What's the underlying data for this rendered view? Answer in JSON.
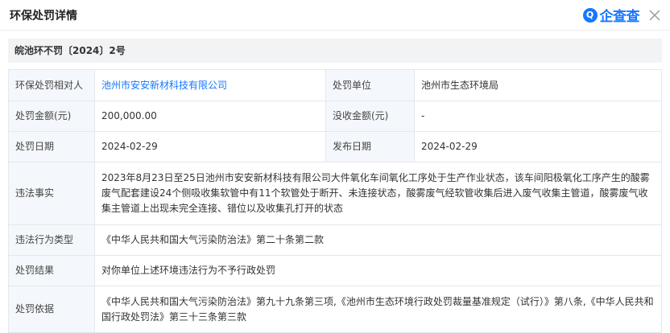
{
  "header": {
    "title": "环保处罚详情",
    "logo_icon_glyph": "Q",
    "logo_text": "企查查",
    "close_icon": "close-icon"
  },
  "doc_number": "皖池环不罚〔2024〕2号",
  "rows": {
    "party_label": "环保处罚相对人",
    "party_value": "池州市安安新材科技有限公司",
    "unit_label": "处罚单位",
    "unit_value": "池州市生态环境局",
    "amount_label": "处罚金额(元)",
    "amount_value": "200,000.00",
    "confiscated_label": "没收金额(元)",
    "confiscated_value": "-",
    "date_label": "处罚日期",
    "date_value": "2024-02-29",
    "publish_label": "发布日期",
    "publish_value": "2024-02-29",
    "facts_label": "违法事实",
    "facts_value": "2023年8月23日至25日池州市安安新材科技有限公司大件氧化车间氧化工序处于生产作业状态，该车间阳极氧化工序产生的酸雾废气配套建设24个侧吸收集软管中有11个软管处于断开、未连接状态，酸雾废气经软管收集后进入废气收集主管道，酸雾废气收集主管道上出现未完全连接、错位以及收集孔打开的状态",
    "type_label": "违法行为类型",
    "type_value": "《中华人民共和国大气污染防治法》第二十条第二款",
    "result_label": "处罚结果",
    "result_value": "对你单位上述环境违法行为不予行政处罚",
    "basis_label": "处罚依据",
    "basis_value": "《中华人民共和国大气污染防治法》第九十九条第三项,《池州市生态环境行政处罚裁量基准规定（试行）》第八条,《中华人民共和国行政处罚法》第三十三条第三款"
  },
  "colors": {
    "accent": "#1677ff",
    "label_bg": "#f4f7fb",
    "border": "#e4e7ed"
  }
}
